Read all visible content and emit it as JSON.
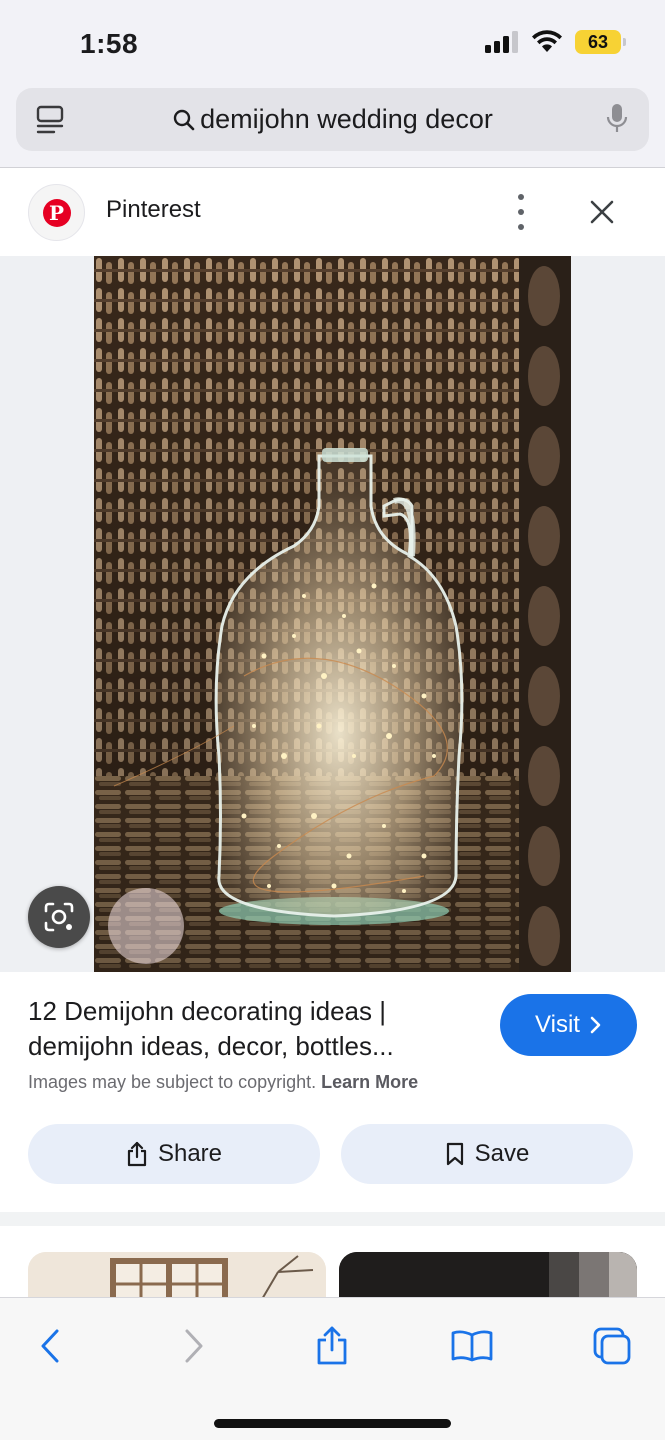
{
  "status_bar": {
    "time": "1:58",
    "battery": "63"
  },
  "search": {
    "query": "demijohn wedding decor"
  },
  "source": {
    "name": "Pinterest"
  },
  "result": {
    "title": "12 Demijohn decorating ideas | demijohn ideas, decor, bottles...",
    "visit_label": "Visit",
    "copyright_text": "Images may be subject to copyright.",
    "learn_more": "Learn More",
    "share_label": "Share",
    "save_label": "Save"
  },
  "colors": {
    "accent": "#1a73e8",
    "pill_bg": "#e8eef9",
    "pinterest_red": "#e60023",
    "battery": "#f7d234",
    "ios_blue": "#1a73e8"
  },
  "icons": {
    "tabs": "tabs-icon",
    "search": "search-icon",
    "mic": "microphone-icon",
    "more": "more-vertical-icon",
    "close": "close-icon",
    "lens": "google-lens-icon",
    "share": "share-icon",
    "save": "bookmark-icon",
    "back": "back-arrow-icon",
    "forward": "forward-arrow-icon",
    "toolbar_share": "share-icon",
    "bookmarks": "book-icon",
    "tab_switcher": "tabs-icon"
  }
}
